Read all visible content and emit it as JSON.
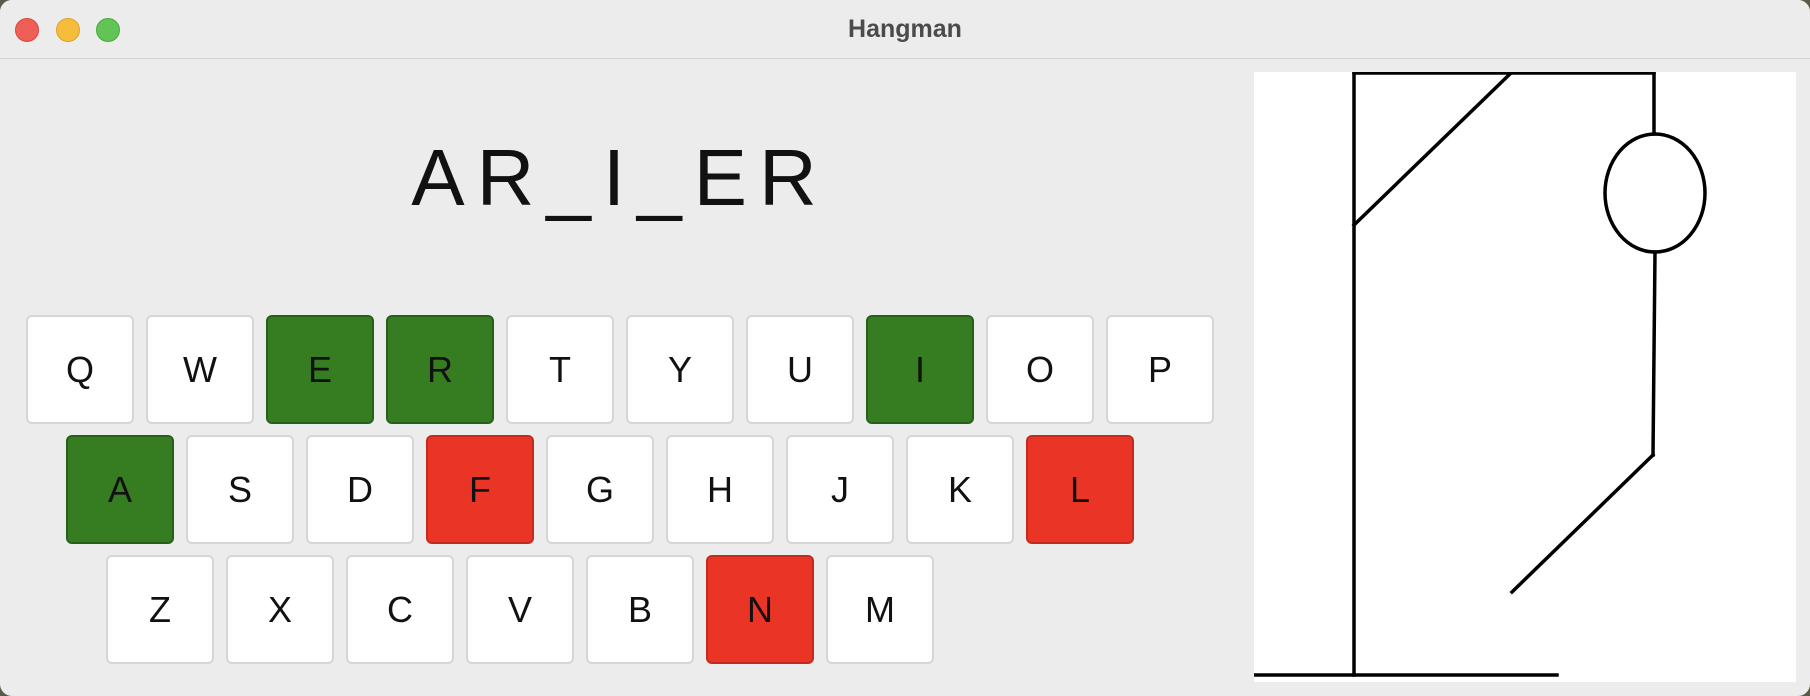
{
  "window": {
    "title": "Hangman"
  },
  "game": {
    "word_display": "AR_I_ER"
  },
  "keyboard": {
    "rows": [
      [
        {
          "letter": "Q",
          "state": "unused"
        },
        {
          "letter": "W",
          "state": "unused"
        },
        {
          "letter": "E",
          "state": "correct"
        },
        {
          "letter": "R",
          "state": "correct"
        },
        {
          "letter": "T",
          "state": "unused"
        },
        {
          "letter": "Y",
          "state": "unused"
        },
        {
          "letter": "U",
          "state": "unused"
        },
        {
          "letter": "I",
          "state": "correct"
        },
        {
          "letter": "O",
          "state": "unused"
        },
        {
          "letter": "P",
          "state": "unused"
        }
      ],
      [
        {
          "letter": "A",
          "state": "correct"
        },
        {
          "letter": "S",
          "state": "unused"
        },
        {
          "letter": "D",
          "state": "unused"
        },
        {
          "letter": "F",
          "state": "wrong"
        },
        {
          "letter": "G",
          "state": "unused"
        },
        {
          "letter": "H",
          "state": "unused"
        },
        {
          "letter": "J",
          "state": "unused"
        },
        {
          "letter": "K",
          "state": "unused"
        },
        {
          "letter": "L",
          "state": "wrong"
        }
      ],
      [
        {
          "letter": "Z",
          "state": "unused"
        },
        {
          "letter": "X",
          "state": "unused"
        },
        {
          "letter": "C",
          "state": "unused"
        },
        {
          "letter": "V",
          "state": "unused"
        },
        {
          "letter": "B",
          "state": "unused"
        },
        {
          "letter": "N",
          "state": "wrong"
        },
        {
          "letter": "M",
          "state": "unused"
        }
      ]
    ]
  },
  "hangman": {
    "parts_visible": [
      "base",
      "pole",
      "beam",
      "brace",
      "rope",
      "head",
      "body",
      "left-leg"
    ]
  },
  "colors": {
    "correct": "#367d22",
    "wrong": "#e93426",
    "unused": "#ffffff"
  }
}
